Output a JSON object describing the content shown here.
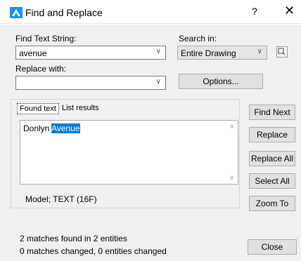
{
  "window": {
    "title": "Find and Replace",
    "help_label": "?",
    "close_label": "✕"
  },
  "find": {
    "label": "Find Text String:",
    "value": "avenue"
  },
  "search_in": {
    "label": "Search in:",
    "value": "Entire Drawing"
  },
  "replace": {
    "label": "Replace with:",
    "value": ""
  },
  "options_button": "Options...",
  "tabs": [
    {
      "label": "Found text",
      "active": true
    },
    {
      "label": "List results",
      "active": false
    }
  ],
  "found_text": {
    "prefix": "Donlyn ",
    "highlight": "Avenue"
  },
  "context": "Model; TEXT (16F)",
  "buttons": {
    "find_next": "Find Next",
    "replace": "Replace",
    "replace_all": "Replace All",
    "select_all": "Select All",
    "zoom_to": "Zoom To",
    "close": "Close"
  },
  "status": {
    "line1": "2 matches found in 2 entities",
    "line2": "0 matches changed, 0 entities changed"
  },
  "colors": {
    "selection": "#0078d7",
    "window_bg": "#f0f0f0"
  }
}
